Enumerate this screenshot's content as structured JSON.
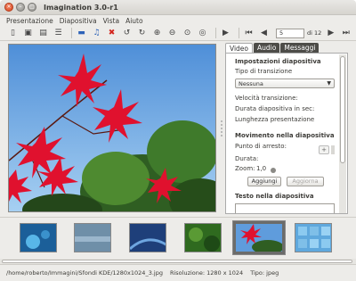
{
  "window": {
    "title": "Imagination 3.0-r1"
  },
  "menu": [
    "Presentazione",
    "Diapositiva",
    "Vista",
    "Aiuto"
  ],
  "toolbar": {
    "page_value": "5",
    "page_total": "di 12"
  },
  "panel": {
    "tabs": [
      "Video",
      "Audio",
      "Messaggi"
    ],
    "settings_header": "Impostazioni diapositiva",
    "transition_label": "Tipo di transizione",
    "transition_value": "Nessuna",
    "speed_label": "Velocità transizione:",
    "duration_label": "Durata diapositiva in sec:",
    "length_label": "Lunghezza presentazione",
    "movement_header": "Movimento nella diapositiva",
    "stop_point_label": "Punto di arresto:",
    "duration2_label": "Durata:",
    "zoom_label": "Zoom:",
    "zoom_value": "1,0",
    "add_button": "Aggiungi",
    "update_button": "Aggiorna",
    "text_header": "Testo nella diapositiva"
  },
  "status": {
    "path": "/home/roberto/Immagini/Sfondi KDE/1280x1024_3.jpg",
    "resolution": "Risoluzione: 1280 x 1024",
    "type": "Tipo: jpeg"
  },
  "icons": {
    "toolbar": [
      "new-slideshow-icon",
      "open-icon",
      "save-icon",
      "properties-icon",
      "add-image-icon",
      "add-audio-icon",
      "delete-icon",
      "rotate-left-icon",
      "rotate-right-icon",
      "zoom-in-icon",
      "zoom-out-icon",
      "zoom-fit-icon",
      "zoom-normal-icon",
      "play-icon",
      "first-icon",
      "prev-icon",
      "next-icon",
      "last-icon"
    ]
  },
  "colors": {
    "accent_red": "#d3251d",
    "close_button": "#d8461f",
    "sky": "#5f9cdc"
  }
}
